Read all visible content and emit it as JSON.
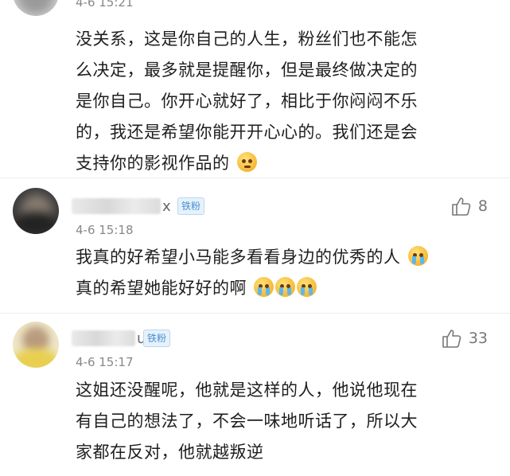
{
  "comments": [
    {
      "time": "4-6 15:21",
      "text_lines": [
        "没关系，这是你自己的人生，粉丝们也不能怎",
        "么决定，最多就是提醒你，但是最终做决定的",
        "是你自己。你开心就好了，相比于你闷闷不乐",
        "的，我还是希望你能开开心心的。我们还是会",
        "支持你的影视作品的"
      ],
      "emoji": "meh-face-icon"
    },
    {
      "name_tail": "x",
      "badge": "铁粉",
      "time": "4-6 15:18",
      "likes": "8",
      "text_lines": [
        "我真的好希望小马能多看看身边的优秀的人",
        "真的希望她能好好的啊"
      ],
      "emoji": "crying-face-icon"
    },
    {
      "name_tail": "u",
      "badge": "铁粉",
      "time": "4-6 15:17",
      "likes": "33",
      "text_lines": [
        "这姐还没醒呢，他就是这样的人，他说他现在",
        "有自己的想法了，不会一味地听话了，所以大",
        "家都在反对，他就越叛逆"
      ]
    }
  ],
  "colors": {
    "badge_bg": "#e6f2fb",
    "badge_text": "#4a8fd0",
    "time": "#888888"
  }
}
